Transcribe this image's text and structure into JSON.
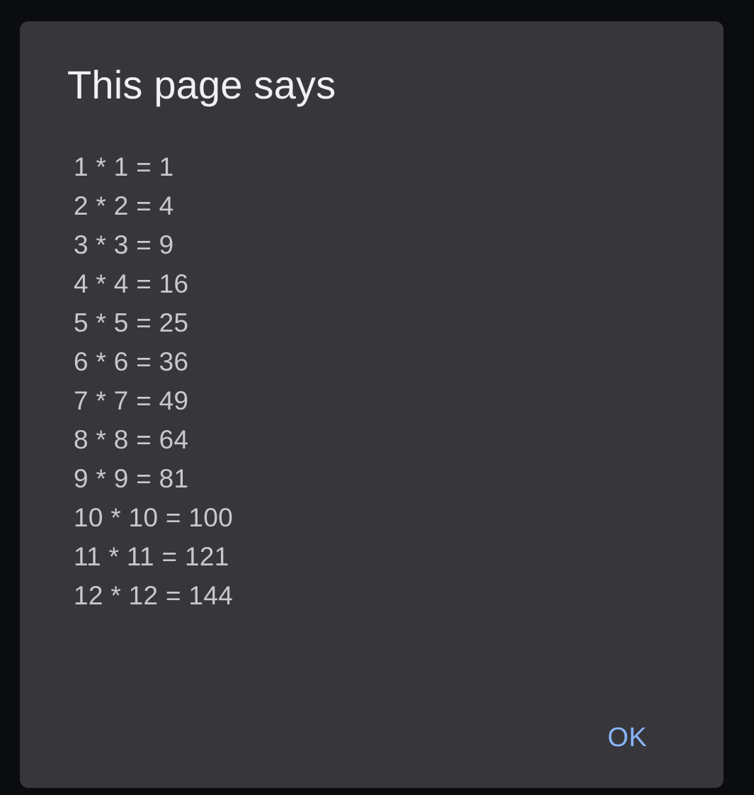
{
  "dialog": {
    "title": "This page says",
    "message_lines": [
      "1 * 1 = 1",
      "2 * 2 = 4",
      "3 * 3 = 9",
      "4 * 4 = 16",
      "5 * 5 = 25",
      "6 * 6 = 36",
      "7 * 7 = 49",
      "8 * 8 = 64",
      "9 * 9 = 81",
      "10 * 10 = 100",
      "11 * 11 = 121",
      "12 * 12 = 144"
    ],
    "ok_label": "OK"
  },
  "colors": {
    "backdrop": "#0b0c0e",
    "dialog_background": "#36363b",
    "title_text": "#f1f1f3",
    "message_text": "#c8c8cd",
    "button_accent": "#8ab4f8"
  }
}
